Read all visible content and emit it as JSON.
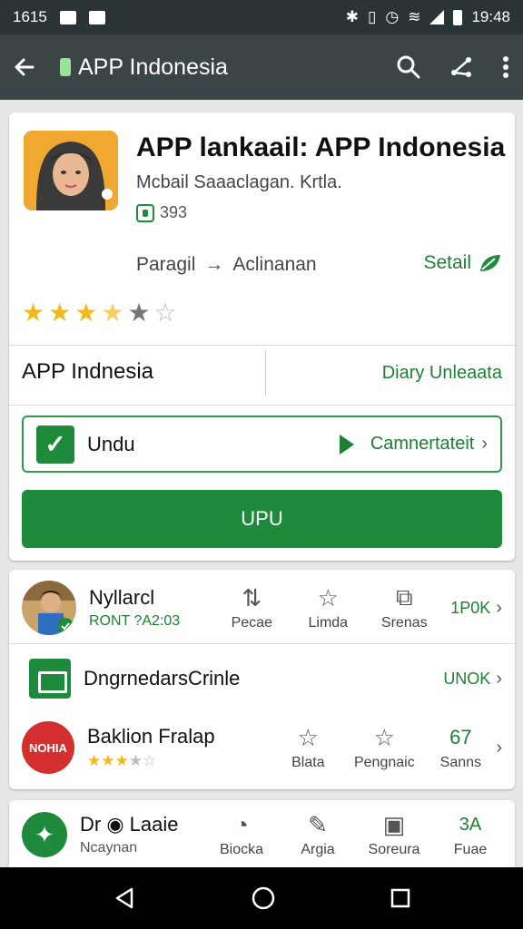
{
  "status_bar": {
    "time_left": "1615",
    "time_right": "19:48"
  },
  "app_bar": {
    "title": "APP Indonesia",
    "icons": [
      "back-arrow-icon",
      "search-icon",
      "share-icon",
      "more-vert-icon"
    ]
  },
  "app": {
    "title": "APP lankaail: APP Indonesia",
    "subtitle": "Mcbail Saaaclagan. Krtla.",
    "meta": "393",
    "path_from": "Paragil",
    "path_arrow": "→",
    "path_to": "Aclinanan",
    "setail_label": "Setail",
    "rating_stars": 3.5,
    "name_left": "APP Indnesia",
    "name_right": "Diary Unleaata",
    "undu_label": "Undu",
    "undu_right": "Camnertateit",
    "primary_button": "UPU"
  },
  "list": [
    {
      "title": "Nyllarcl",
      "sub": "RONT ?A2:03",
      "actions": [
        {
          "icon": "up-down-icon",
          "label": "Pecae"
        },
        {
          "icon": "star-icon",
          "label": "Limda"
        },
        {
          "icon": "screen-icon",
          "label": "Srenas"
        }
      ],
      "link": "1P0K"
    },
    {
      "title": "DngrnedarsCrinle",
      "link": "UNOK"
    },
    {
      "title": "Baklion Fralap",
      "logo_text": "NOHIA",
      "stars": 3,
      "actions": [
        {
          "icon": "star-outline-icon",
          "label": "Blata"
        },
        {
          "icon": "star-outline-icon",
          "label": "Pengnaic"
        }
      ],
      "link": "67",
      "link_sub": "Sanns"
    }
  ],
  "bottom_row": {
    "title": "Dr",
    "title_suffix": "Laaie",
    "sub": "Ncaynan",
    "actions": [
      {
        "icon": "timer-icon",
        "label": "Biocka"
      },
      {
        "icon": "pin-icon",
        "label": "Argia"
      },
      {
        "icon": "screen-icon",
        "label": "Soreura"
      }
    ],
    "link": "3A",
    "link_sub": "Fuae"
  },
  "colors": {
    "accent": "#1e8a3c",
    "app_bar": "#3b4447",
    "status_bar": "#2a3336",
    "star": "#f5b81c"
  }
}
